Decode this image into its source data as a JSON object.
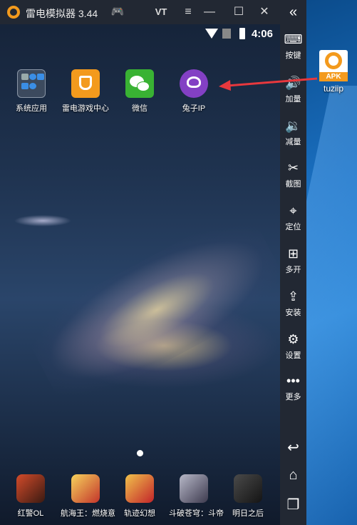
{
  "window": {
    "title": "雷电模拟器 3.44",
    "vt_label": "VT"
  },
  "status_bar": {
    "time": "4:06"
  },
  "home_apps": [
    {
      "label": "系统应用",
      "icon": "system-apps-folder-icon"
    },
    {
      "label": "雷电游戏中心",
      "icon": "leidian-game-center-icon"
    },
    {
      "label": "微信",
      "icon": "wechat-icon"
    },
    {
      "label": "兔子IP",
      "icon": "tuzi-ip-icon"
    }
  ],
  "dock_apps": [
    {
      "label": "红警OL"
    },
    {
      "label": "航海王：燃烧意"
    },
    {
      "label": "轨迹幻想"
    },
    {
      "label": "斗破苍穹：斗帝"
    },
    {
      "label": "明日之后"
    }
  ],
  "sidebar": {
    "items": [
      {
        "label": "按键",
        "icon": "keyboard-icon"
      },
      {
        "label": "加量",
        "icon": "volume-up-icon"
      },
      {
        "label": "减量",
        "icon": "volume-down-icon"
      },
      {
        "label": "截图",
        "icon": "scissors-icon"
      },
      {
        "label": "定位",
        "icon": "location-pin-icon"
      },
      {
        "label": "多开",
        "icon": "multi-instance-icon"
      },
      {
        "label": "安装",
        "icon": "install-apk-icon"
      },
      {
        "label": "设置",
        "icon": "gear-icon"
      },
      {
        "label": "更多",
        "icon": "more-dots-icon"
      }
    ]
  },
  "desktop": {
    "shortcut_name": "tuziip",
    "shortcut_badge": "APK"
  },
  "colors": {
    "chrome": "#222833",
    "brand_orange": "#f39a1d",
    "annotation_arrow": "#e8383d"
  }
}
